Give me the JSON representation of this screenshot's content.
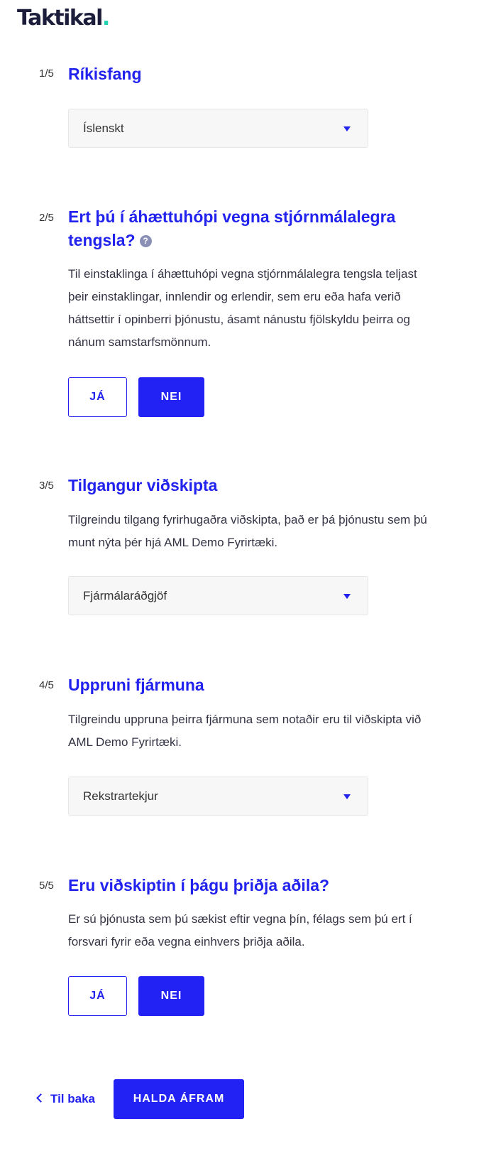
{
  "header": {
    "logo_text": "Taktikal",
    "logo_dot": "."
  },
  "questions": [
    {
      "number": "1/5",
      "title": "Ríkisfang",
      "select_value": "Íslenskt"
    },
    {
      "number": "2/5",
      "title": "Ert þú í áhættuhópi vegna stjórnmálalegra tengsla?",
      "help_icon": "question-mark-icon",
      "description": "Til einstaklinga í áhættuhópi vegna stjórnmálalegra tengsla teljast þeir einstaklingar, innlendir og erlendir, sem eru eða hafa verið háttsettir í opinberri þjónustu, ásamt nánustu fjölskyldu þeirra og nánum samstarfsmönnum.",
      "yes_label": "JÁ",
      "no_label": "NEI",
      "selected": "NEI"
    },
    {
      "number": "3/5",
      "title": "Tilgangur viðskipta",
      "description": "Tilgreindu tilgang fyrirhugaðra viðskipta, það er þá þjónustu sem þú munt nýta þér hjá AML Demo Fyrirtæki.",
      "select_value": "Fjármálaráðgjöf"
    },
    {
      "number": "4/5",
      "title": "Uppruni fjármuna",
      "description": "Tilgreindu uppruna þeirra fjármuna sem notaðir eru til viðskipta við AML Demo Fyrirtæki.",
      "select_value": "Rekstrartekjur"
    },
    {
      "number": "5/5",
      "title": "Eru viðskiptin í þágu þriðja aðila?",
      "description": "Er sú þjónusta sem þú sækist eftir vegna þín, félags sem þú ert í forsvari fyrir eða vegna einhvers þriðja aðila.",
      "yes_label": "JÁ",
      "no_label": "NEI",
      "selected": "NEI"
    }
  ],
  "footer": {
    "back_label": "Til baka",
    "continue_label": "HALDA ÁFRAM"
  },
  "colors": {
    "accent": "#2222ee",
    "logo_dot": "#1fd1b1",
    "select_bg": "#f7f7f7"
  }
}
